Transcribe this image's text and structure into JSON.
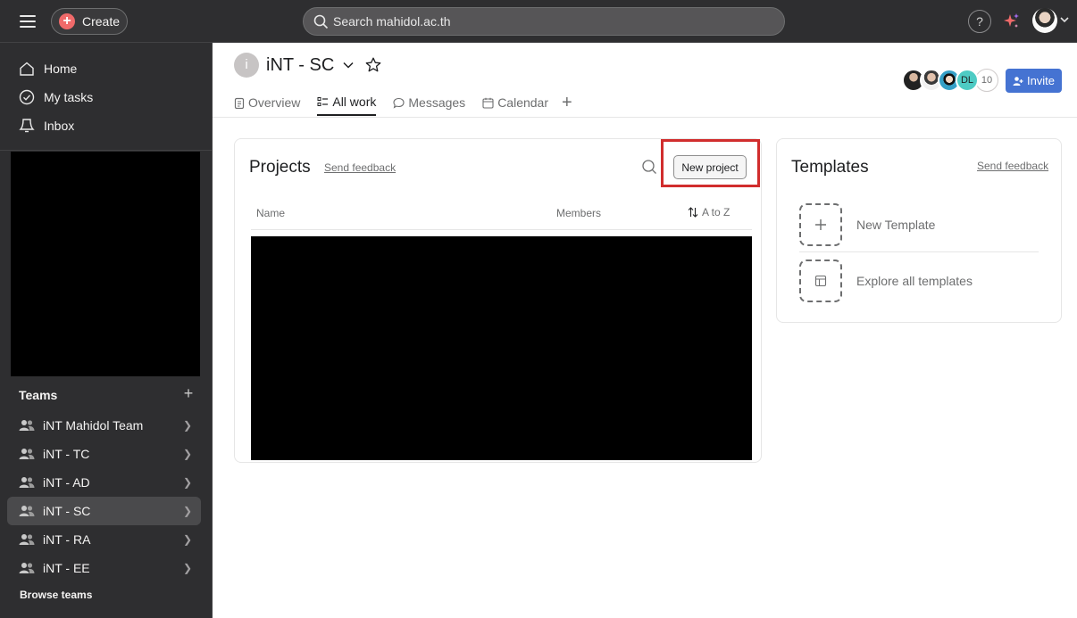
{
  "topbar": {
    "create_label": "Create",
    "search_placeholder": "Search mahidol.ac.th",
    "help_label": "?"
  },
  "sidebar": {
    "nav": [
      {
        "label": "Home",
        "icon": "home-icon"
      },
      {
        "label": "My tasks",
        "icon": "check-circle-icon"
      },
      {
        "label": "Inbox",
        "icon": "inbox-icon"
      }
    ],
    "teams_heading": "Teams",
    "teams": [
      {
        "label": "iNT Mahidol Team",
        "active": false
      },
      {
        "label": "iNT - TC",
        "active": false
      },
      {
        "label": "iNT - AD",
        "active": false
      },
      {
        "label": "iNT - SC",
        "active": true
      },
      {
        "label": "iNT - RA",
        "active": false
      },
      {
        "label": "iNT - EE",
        "active": false
      }
    ],
    "browse_teams": "Browse teams"
  },
  "header": {
    "team_initial": "i",
    "team_name": "iNT - SC",
    "tabs": [
      {
        "label": "Overview",
        "icon": "clipboard-icon",
        "active": false
      },
      {
        "label": "All work",
        "icon": "list-icon",
        "active": true
      },
      {
        "label": "Messages",
        "icon": "message-icon",
        "active": false
      },
      {
        "label": "Calendar",
        "icon": "calendar-icon",
        "active": false
      }
    ],
    "member_initials": "DL",
    "member_count": "10",
    "invite_label": "Invite"
  },
  "projects": {
    "title": "Projects",
    "send_feedback": "Send feedback",
    "new_project": "New project",
    "col_name": "Name",
    "col_members": "Members",
    "sort_label": "A to Z"
  },
  "templates": {
    "title": "Templates",
    "send_feedback": "Send feedback",
    "items": [
      {
        "label": "New Template",
        "icon": "plus-icon"
      },
      {
        "label": "Explore all templates",
        "icon": "template-icon"
      }
    ]
  },
  "colors": {
    "topbar_bg": "#2e2e30",
    "invite_blue": "#4573d2",
    "create_plus": "#f06a6a",
    "highlight_red": "#d12d2d"
  }
}
